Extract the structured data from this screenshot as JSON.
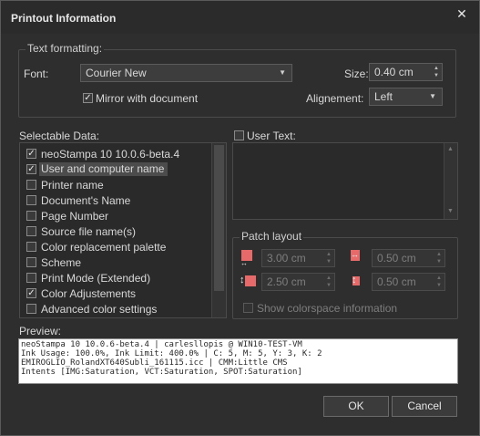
{
  "window": {
    "title": "Printout Information",
    "close_glyph": "✕"
  },
  "text_formatting": {
    "legend": "Text formatting:",
    "font_label": "Font:",
    "font_value": "Courier New",
    "mirror_label": "Mirror with document",
    "mirror_checked": true,
    "size_label": "Size:",
    "size_value": "0.40 cm",
    "alignment_label": "Alignement:",
    "alignment_value": "Left"
  },
  "selectable_data": {
    "label": "Selectable Data:",
    "items": [
      {
        "label": "neoStampa 10 10.0.6-beta.4",
        "checked": true,
        "selected": false
      },
      {
        "label": "User and computer name",
        "checked": true,
        "selected": true
      },
      {
        "label": "Printer name",
        "checked": false,
        "selected": false
      },
      {
        "label": "Document's Name",
        "checked": false,
        "selected": false
      },
      {
        "label": "Page Number",
        "checked": false,
        "selected": false
      },
      {
        "label": "Source file name(s)",
        "checked": false,
        "selected": false
      },
      {
        "label": "Color replacement palette",
        "checked": false,
        "selected": false
      },
      {
        "label": "Scheme",
        "checked": false,
        "selected": false
      },
      {
        "label": "Print Mode (Extended)",
        "checked": false,
        "selected": false
      },
      {
        "label": "Color Adjustements",
        "checked": true,
        "selected": false
      },
      {
        "label": "Advanced color settings",
        "checked": false,
        "selected": false
      }
    ]
  },
  "user_text": {
    "label": "User Text:",
    "checked": false,
    "value": ""
  },
  "patch_layout": {
    "legend": "Patch layout",
    "width_value": "3.00 cm",
    "horizontal_gap_value": "0.50 cm",
    "height_value": "2.50 cm",
    "vertical_gap_value": "0.50 cm",
    "show_colorspace_label": "Show colorspace information",
    "show_colorspace_checked": false
  },
  "preview": {
    "label": "Preview:",
    "lines": [
      "neoStampa 10 10.0.6-beta.4 | carlesllopis @ WIN10-TEST-VM",
      "Ink Usage: 100.0%, Ink Limit: 400.0% | C: 5, M: 5, Y: 3, K: 2",
      "EMIROGLIO_RolandXT640Subli_161115.icc | CMM:Little CMS",
      "Intents [IMG:Saturation, VCT:Saturation, SPOT:Saturation]"
    ]
  },
  "buttons": {
    "ok": "OK",
    "cancel": "Cancel"
  },
  "colors": {
    "patch_swatch": "#e66a6a",
    "preview_bg": "#ffffff",
    "dialog_bg": "#2e2e2e"
  }
}
